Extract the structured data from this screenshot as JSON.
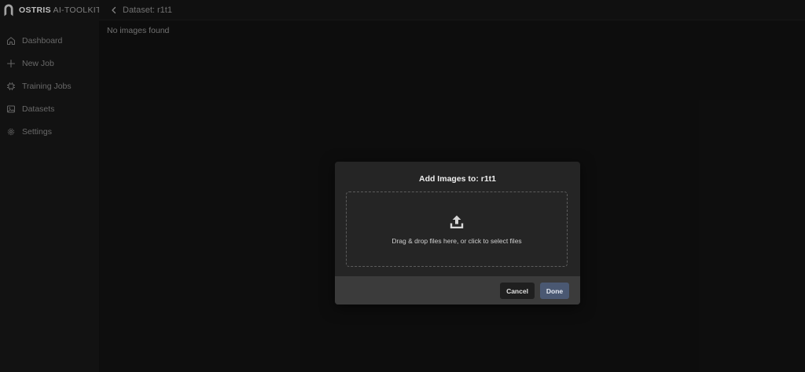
{
  "brand": {
    "name_bold": "OSTRIS",
    "name_light": "AI-TOOLKIT",
    "logo_icon": "ostris-logo-icon"
  },
  "sidebar": {
    "items": [
      {
        "label": "Dashboard",
        "icon": "home-icon"
      },
      {
        "label": "New Job",
        "icon": "plus-icon"
      },
      {
        "label": "Training Jobs",
        "icon": "cpu-icon"
      },
      {
        "label": "Datasets",
        "icon": "images-icon"
      },
      {
        "label": "Settings",
        "icon": "gear-icon"
      }
    ]
  },
  "header": {
    "back_icon": "chevron-left-icon",
    "title": "Dataset: r1t1"
  },
  "main": {
    "empty_message": "No images found"
  },
  "modal": {
    "title": "Add Images to: r1t1",
    "dropzone_icon": "upload-icon",
    "dropzone_text": "Drag & drop files here, or click to select files",
    "cancel_label": "Cancel",
    "done_label": "Done"
  },
  "colors": {
    "background": "#111111",
    "sidebar": "#161616",
    "modal": "#252525",
    "modal_footer": "#3b3b3b",
    "done_button": "#4a5872",
    "cancel_button": "#1f1f1f"
  }
}
